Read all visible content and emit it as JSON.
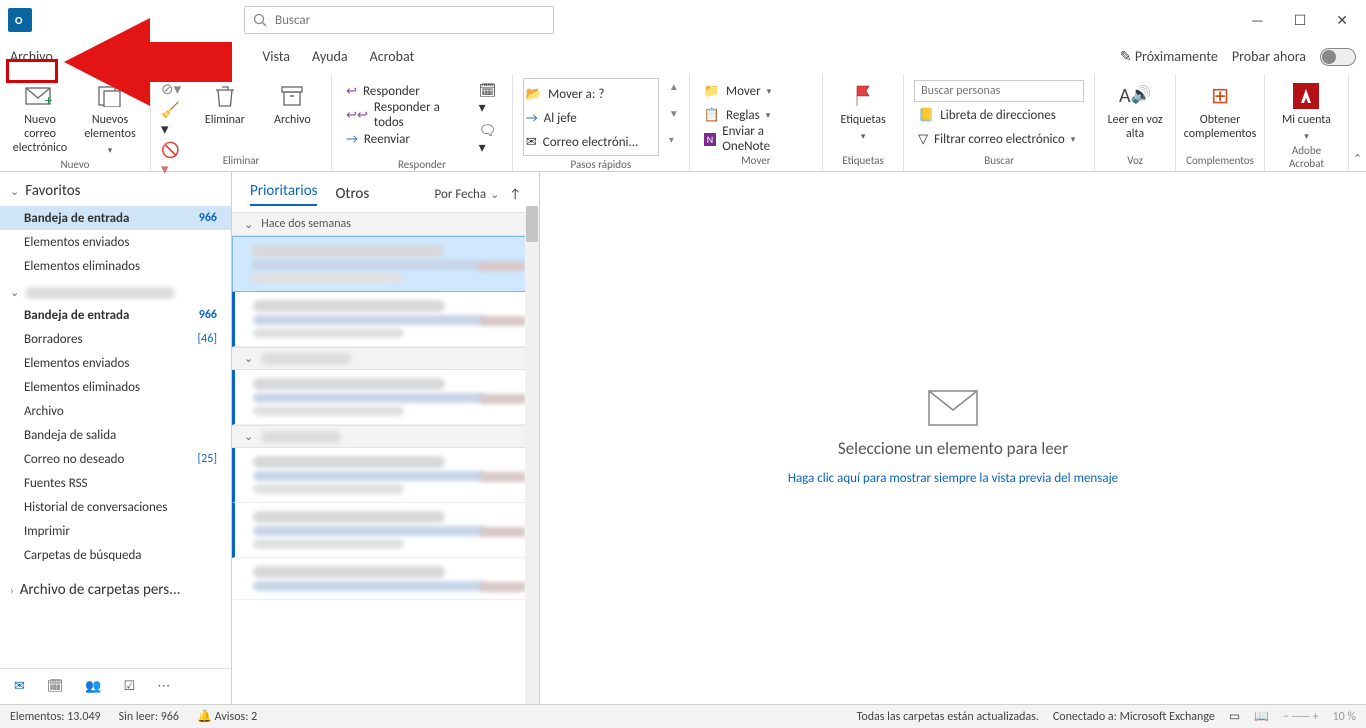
{
  "title_search_placeholder": "Buscar",
  "tabs": {
    "archivo": "Archivo",
    "vista": "Vista",
    "ayuda": "Ayuda",
    "acrobat": "Acrobat",
    "prox": "Próximamente",
    "probar": "Probar ahora"
  },
  "ribbon": {
    "nuevo": {
      "label": "Nuevo",
      "correo": "Nuevo correo electrónico",
      "elementos": "Nuevos elementos"
    },
    "eliminar": {
      "label": "Eliminar",
      "eliminar": "Eliminar",
      "archivo": "Archivo"
    },
    "responder": {
      "label": "Responder",
      "responder": "Responder",
      "todos": "Responder a todos",
      "reenviar": "Reenviar"
    },
    "pasos": {
      "label": "Pasos rápidos",
      "mover": "Mover a: ?",
      "jefe": "Al jefe",
      "correo": "Correo electróni..."
    },
    "mover": {
      "label": "Mover",
      "mover": "Mover",
      "reglas": "Reglas",
      "onenote": "Enviar a OneNote"
    },
    "etiquetas": {
      "label": "Etiquetas",
      "etiquetas": "Etiquetas"
    },
    "buscar": {
      "label": "Buscar",
      "placeholder": "Buscar personas",
      "libreta": "Libreta de direcciones",
      "filtrar": "Filtrar correo electrónico"
    },
    "voz": {
      "label": "Voz",
      "leer": "Leer en voz alta"
    },
    "compl": {
      "label": "Complementos",
      "obtener": "Obtener complementos"
    },
    "adobe": {
      "label": "Adobe Acrobat",
      "cuenta": "Mi cuenta"
    }
  },
  "sidebar": {
    "fav": "Favoritos",
    "inbox": "Bandeja de entrada",
    "inbox_cnt": "966",
    "sent": "Elementos enviados",
    "deleted": "Elementos eliminados",
    "drafts": "Borradores",
    "drafts_cnt": "[46]",
    "archive": "Archivo",
    "outbox": "Bandeja de salida",
    "junk": "Correo no deseado",
    "junk_cnt": "[25]",
    "rss": "Fuentes RSS",
    "hist": "Historial de conversaciones",
    "print": "Imprimir",
    "search": "Carpetas de búsqueda",
    "archfold": "Archivo de carpetas pers..."
  },
  "msglist": {
    "prior": "Prioritarios",
    "otros": "Otros",
    "sort": "Por Fecha",
    "grp1": "Hace dos semanas"
  },
  "reader": {
    "title": "Seleccione un elemento para leer",
    "link": "Haga clic aquí para mostrar siempre la vista previa del mensaje"
  },
  "status": {
    "elem": "Elementos: 13.049",
    "unread": "Sin leer: 966",
    "avisos": "Avisos: 2",
    "sync": "Todas las carpetas están actualizadas.",
    "conn": "Conectado a: Microsoft Exchange",
    "zoom": "10 %"
  }
}
